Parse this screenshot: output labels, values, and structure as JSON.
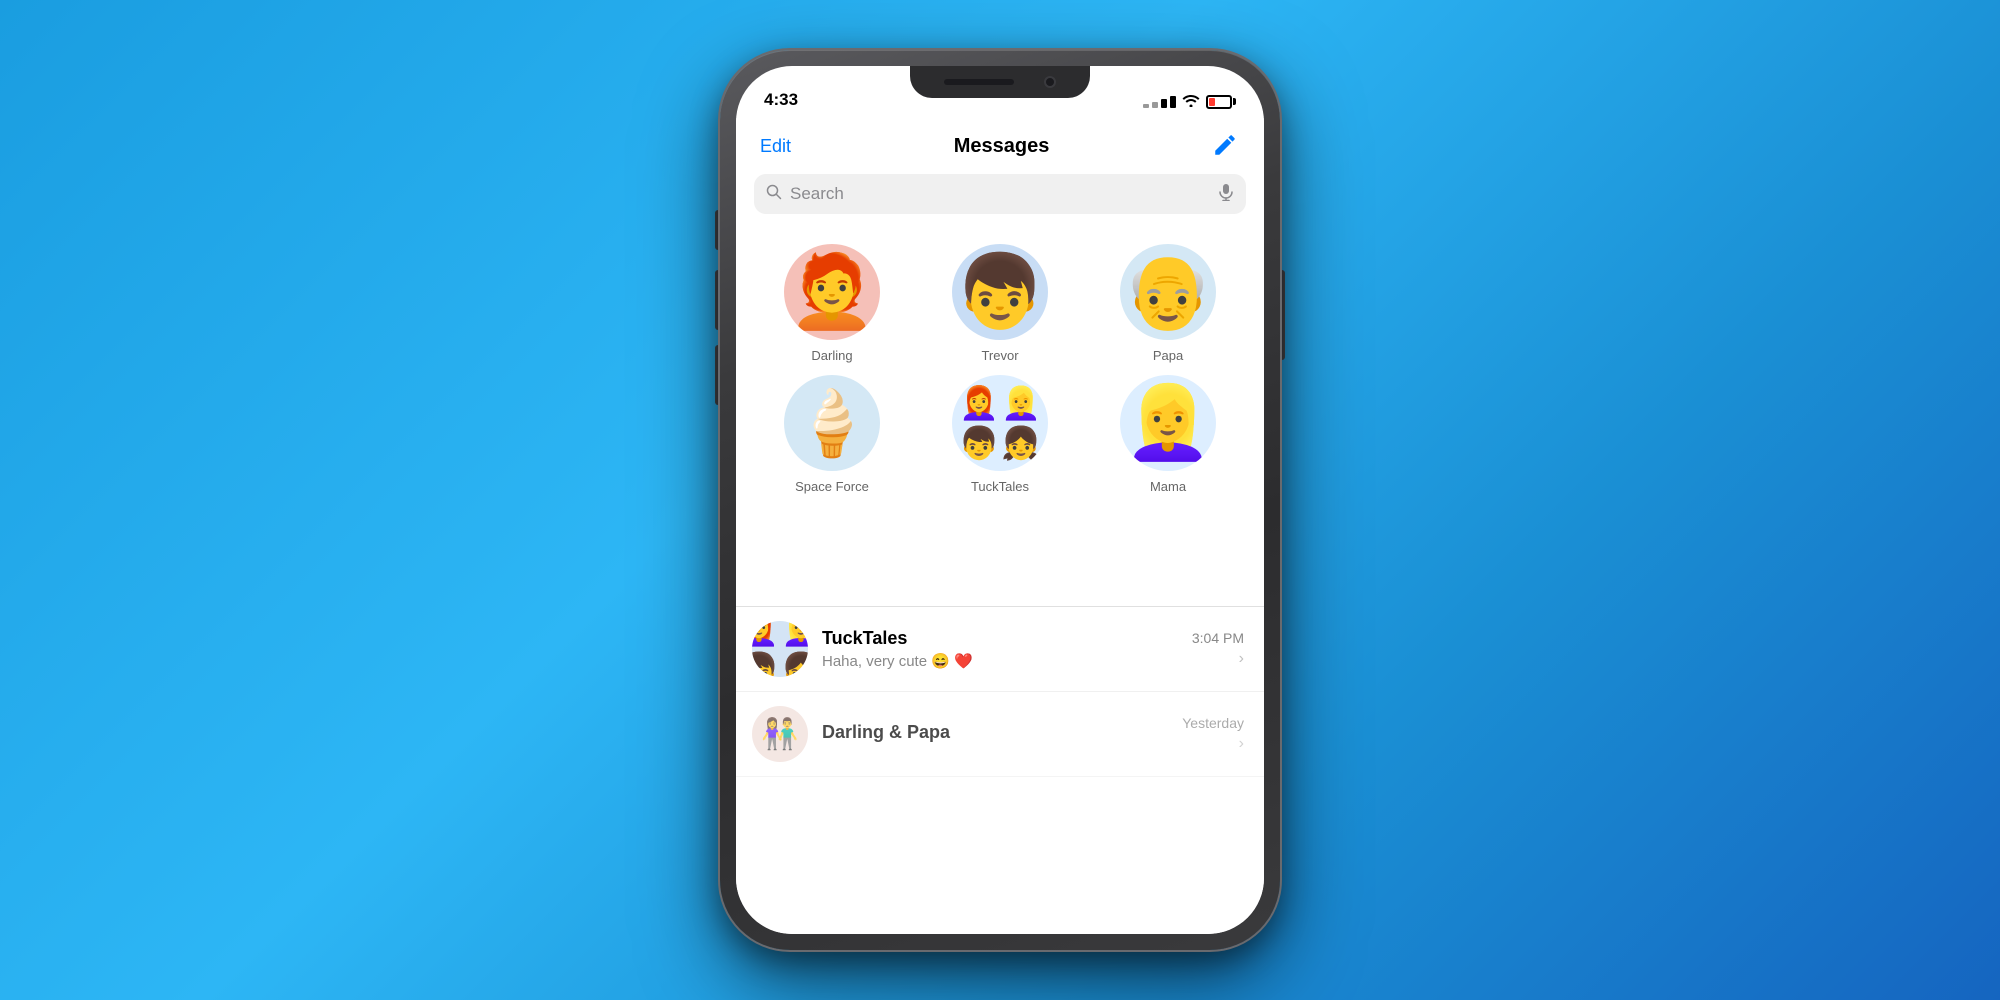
{
  "background": {
    "gradient_start": "#1a9de0",
    "gradient_end": "#1565c0"
  },
  "statusBar": {
    "time": "4:33",
    "battery_level": "low"
  },
  "header": {
    "edit_label": "Edit",
    "title": "Messages",
    "compose_aria": "Compose new message"
  },
  "search": {
    "placeholder": "Search",
    "mic_aria": "Dictate"
  },
  "pinnedContacts": {
    "row1": [
      {
        "id": "darling",
        "name": "Darling",
        "emoji": "👩‍🦰",
        "bg": "#f5c0b8"
      },
      {
        "id": "trevor",
        "name": "Trevor",
        "emoji": "👦",
        "bg": "#c8ddf5"
      },
      {
        "id": "papa",
        "name": "Papa",
        "emoji": "👴",
        "bg": "#d4e8f5"
      }
    ],
    "row2": [
      {
        "id": "spaceforce",
        "name": "Space Force",
        "emoji": "🍦",
        "bg": "#d4e8f5"
      },
      {
        "id": "tucktales",
        "name": "TuckTales",
        "emoji": "👨‍👩‍👧‍👦",
        "bg": "#ddeeff"
      },
      {
        "id": "mama",
        "name": "Mama",
        "emoji": "👱‍♀️",
        "bg": "#ddeeff"
      }
    ]
  },
  "conversations": [
    {
      "id": "tucktales-convo",
      "name": "TuckTales",
      "preview": "Haha, very cute 😄 ❤️",
      "time": "3:04 PM",
      "emoji": "👨‍👩‍👧‍👦"
    },
    {
      "id": "darling-papa-convo",
      "name": "Darling & Papa",
      "preview": "",
      "time": "Yesterday",
      "emoji": "👨‍👩‍👧"
    }
  ]
}
